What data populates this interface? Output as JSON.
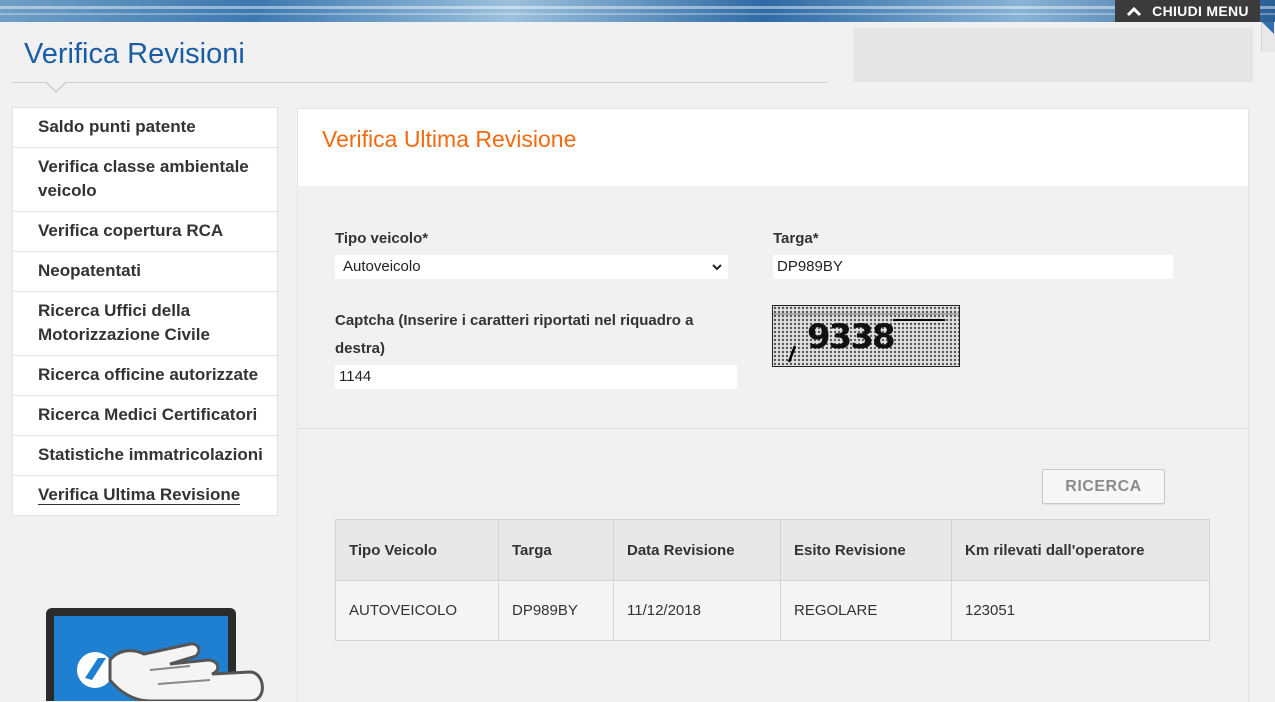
{
  "header": {
    "menu_button": "CHIUDI MENU",
    "page_title": "Verifica Revisioni"
  },
  "sidebar": {
    "items": [
      {
        "label": "Saldo punti patente"
      },
      {
        "label": "Verifica classe ambientale veicolo"
      },
      {
        "label": "Verifica copertura RCA"
      },
      {
        "label": "Neopatentati"
      },
      {
        "label": "Ricerca Uffici della Motorizzazione Civile"
      },
      {
        "label": "Ricerca officine autorizzate"
      },
      {
        "label": "Ricerca Medici Certificatori"
      },
      {
        "label": "Statistiche immatricolazioni"
      },
      {
        "label": "Verifica Ultima Revisione",
        "active": true
      }
    ]
  },
  "form": {
    "title": "Verifica Ultima Revisione",
    "vehicle_type_label": "Tipo veicolo*",
    "vehicle_type_value": "Autoveicolo",
    "plate_label": "Targa*",
    "plate_value": "DP989BY",
    "captcha_label": "Captcha (Inserire i caratteri riportati nel riquadro a destra)",
    "captcha_value": "1144",
    "captcha_image_text": "9338",
    "search_button": "RICERCA"
  },
  "results": {
    "columns": [
      "Tipo Veicolo",
      "Targa",
      "Data Revisione",
      "Esito Revisione",
      "Km rilevati dall'operatore"
    ],
    "rows": [
      [
        "AUTOVEICOLO",
        "DP989BY",
        "11/12/2018",
        "REGOLARE",
        "123051"
      ]
    ]
  },
  "colors": {
    "title_blue": "#1a5da6",
    "accent_orange": "#f26a10",
    "page_bg": "#f1f1f1"
  }
}
